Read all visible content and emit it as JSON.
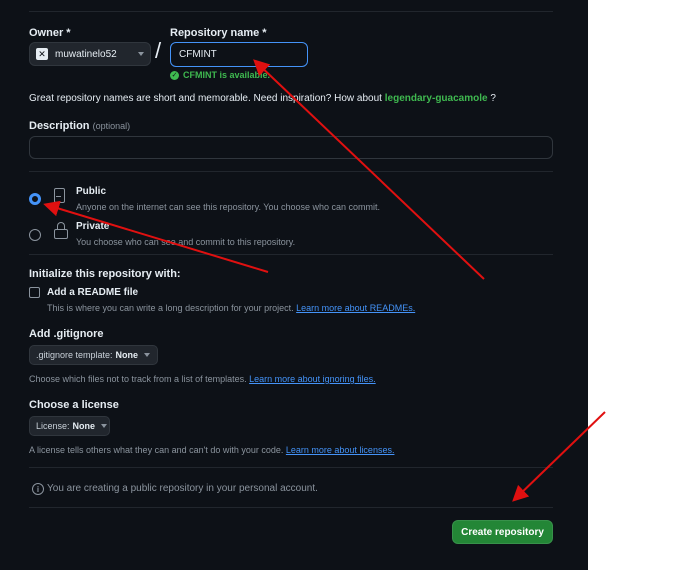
{
  "owner": {
    "label": "Owner *",
    "value": "muwatinelo52"
  },
  "separator": "/",
  "repo": {
    "label": "Repository name *",
    "value": "CFMINT",
    "availability": "CFMINT is available."
  },
  "suggestion": {
    "text": "Great repository names are short and memorable. Need inspiration? How about",
    "name": "legendary-guacamole",
    "end": "?"
  },
  "description": {
    "label": "Description",
    "optional": "(optional)",
    "value": ""
  },
  "visibility": {
    "public": {
      "title": "Public",
      "desc": "Anyone on the internet can see this repository. You choose who can commit.",
      "selected": true
    },
    "private": {
      "title": "Private",
      "desc": "You choose who can see and commit to this repository.",
      "selected": false
    }
  },
  "init": {
    "heading": "Initialize this repository with:",
    "readme": {
      "label": "Add a README file",
      "help": "This is where you can write a long description for your project.",
      "link": "Learn more about READMEs.",
      "checked": false
    }
  },
  "gitignore": {
    "heading": "Add .gitignore",
    "button_prefix": ".gitignore template:",
    "button_value": "None",
    "help": "Choose which files not to track from a list of templates.",
    "link": "Learn more about ignoring files."
  },
  "license": {
    "heading": "Choose a license",
    "button_prefix": "License:",
    "button_value": "None",
    "help": "A license tells others what they can and can't do with your code.",
    "link": "Learn more about licenses."
  },
  "notice": "You are creating a public repository in your personal account.",
  "submit": "Create repository",
  "colors": {
    "bg": "#0d1117",
    "accent": "#238636",
    "success": "#3fb950",
    "link": "#4493f8",
    "annotation": "#e01010"
  }
}
